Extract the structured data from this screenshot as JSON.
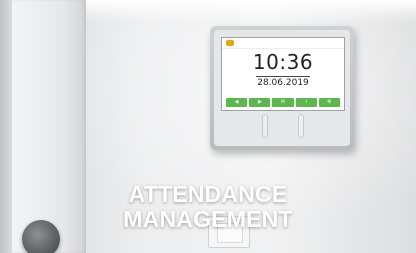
{
  "device": {
    "time": "10:36",
    "date": "28.06.2019",
    "buttons": [
      {
        "icon": "arrow-left-icon",
        "glyph": "◀"
      },
      {
        "icon": "arrow-right-icon",
        "glyph": "▶"
      },
      {
        "icon": "envelope-icon",
        "glyph": "✉"
      },
      {
        "icon": "info-icon",
        "glyph": "i"
      },
      {
        "icon": "settings-icon",
        "glyph": "⚙"
      }
    ]
  },
  "caption": {
    "line1": "ATTENDANCE",
    "line2": "MANAGEMENT"
  },
  "colors": {
    "button_green": "#5bb84a",
    "logo_orange": "#f2a400"
  }
}
